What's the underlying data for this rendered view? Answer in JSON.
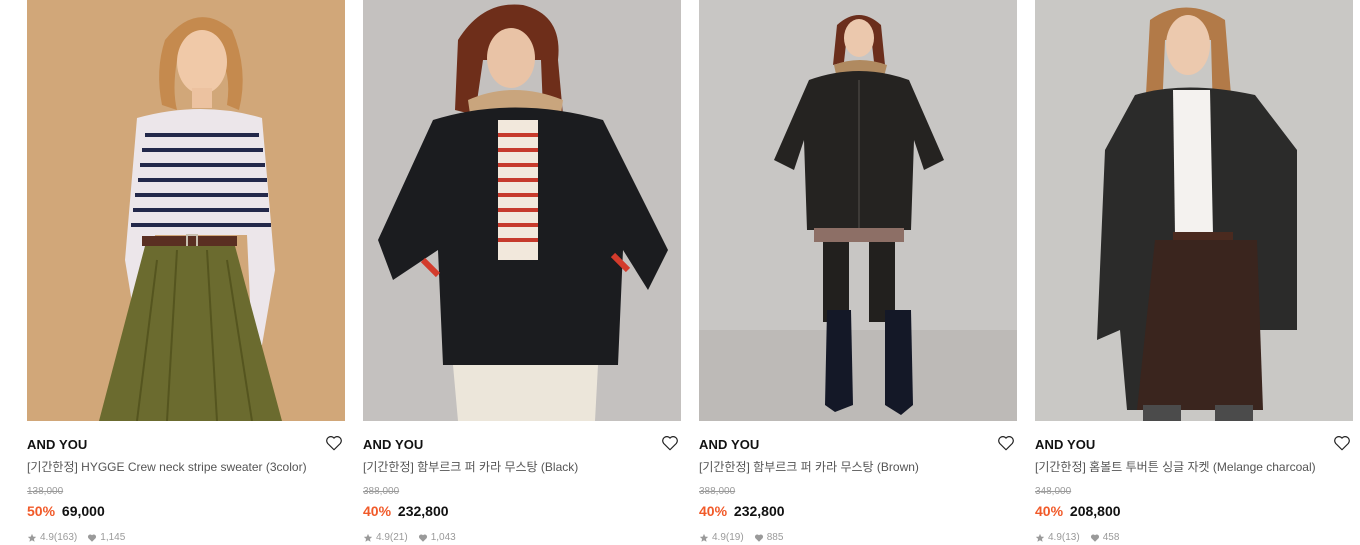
{
  "products": [
    {
      "brand": "AND YOU",
      "title": "[기간한정] HYGGE Crew neck stripe sweater (3color)",
      "original_price": "138,000",
      "discount": "50%",
      "price": "69,000",
      "rating": "4.9",
      "reviews": "(163)",
      "likes": "1,145",
      "image_icon": "model-photo-stripe-sweater"
    },
    {
      "brand": "AND YOU",
      "title": "[기간한정] 함부르크 퍼 카라 무스탕 (Black)",
      "original_price": "388,000",
      "discount": "40%",
      "price": "232,800",
      "rating": "4.9",
      "reviews": "(21)",
      "likes": "1,043",
      "image_icon": "model-photo-black-mustang"
    },
    {
      "brand": "AND YOU",
      "title": "[기간한정] 함부르크 퍼 카라 무스탕 (Brown)",
      "original_price": "388,000",
      "discount": "40%",
      "price": "232,800",
      "rating": "4.9",
      "reviews": "(19)",
      "likes": "885",
      "image_icon": "model-photo-brown-mustang"
    },
    {
      "brand": "AND YOU",
      "title": "[기간한정] 홈볼트 투버튼 싱글 자켓 (Melange charcoal)",
      "original_price": "348,000",
      "discount": "40%",
      "price": "208,800",
      "rating": "4.9",
      "reviews": "(13)",
      "likes": "458",
      "image_icon": "model-photo-charcoal-jacket"
    }
  ],
  "colors": {
    "discount": "#f15a29",
    "meta": "#9a9a9a",
    "brand": "#111111"
  },
  "icons": {
    "wishlist": "heart-outline-icon",
    "rating": "star-icon",
    "likes": "heart-filled-icon"
  }
}
